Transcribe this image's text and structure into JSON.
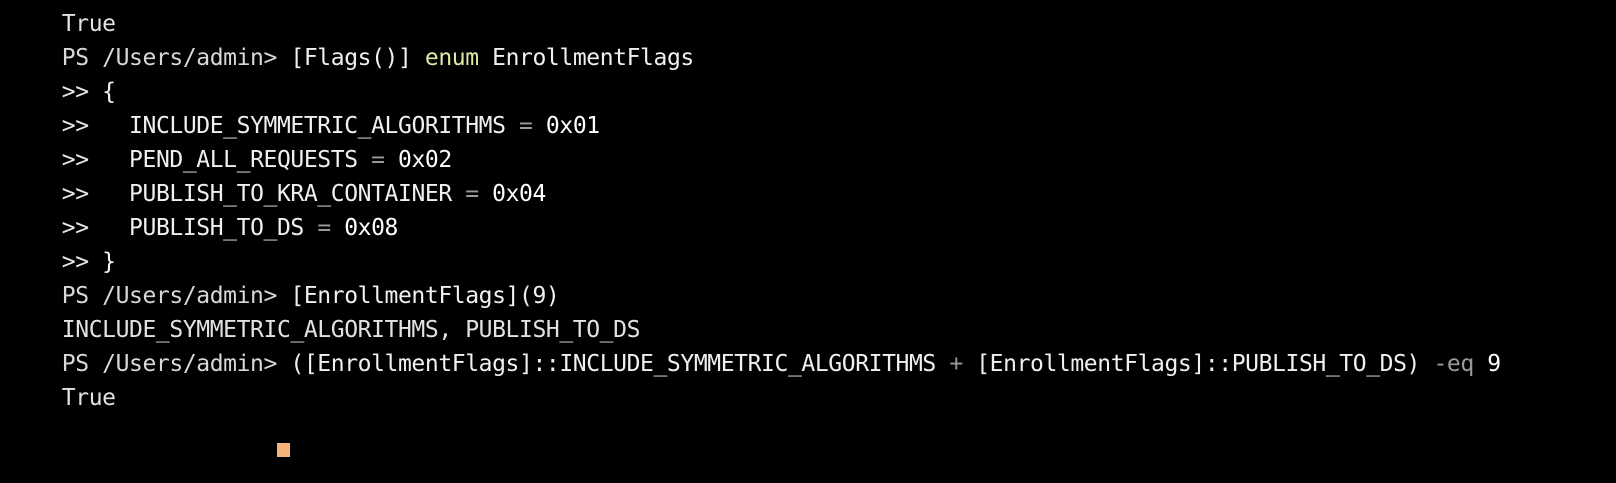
{
  "terminal": {
    "colors": {
      "background": "#000000",
      "text": "#e8e8e8",
      "keyword": "#dfe8a6",
      "operator": "#9a9a9a",
      "cursor": "#f7b27a"
    },
    "prompt": "PS /Users/admin> ",
    "continuation": ">> ",
    "lines": {
      "l0_output": "True",
      "l1_cmd_a": "[Flags()] ",
      "l1_kw": "enum",
      "l1_cmd_b": " EnrollmentFlags",
      "l2_text": "{",
      "l3_indent": "  ",
      "l3_name": "INCLUDE_SYMMETRIC_ALGORITHMS",
      "l3_eq": " = ",
      "l3_val": "0x01",
      "l4_indent": "  ",
      "l4_name": "PEND_ALL_REQUESTS",
      "l4_eq": " = ",
      "l4_val": "0x02",
      "l5_indent": "  ",
      "l5_name": "PUBLISH_TO_KRA_CONTAINER",
      "l5_eq": " = ",
      "l5_val": "0x04",
      "l6_indent": "  ",
      "l6_name": "PUBLISH_TO_DS",
      "l6_eq": " = ",
      "l6_val": "0x08",
      "l7_text": "}",
      "l8_cmd": "[EnrollmentFlags](9)",
      "l9_output": "INCLUDE_SYMMETRIC_ALGORITHMS, PUBLISH_TO_DS",
      "l10_cmd_a": "([EnrollmentFlags]::INCLUDE_SYMMETRIC_ALGORITHMS ",
      "l10_plus": "+",
      "l10_cmd_b": " [EnrollmentFlags]::PUBLISH_TO_DS) ",
      "l10_op": "-eq",
      "l10_num": " 9",
      "l11_output": "True"
    }
  }
}
